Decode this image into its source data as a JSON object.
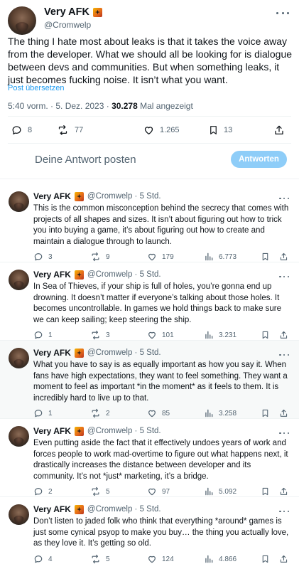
{
  "main_tweet": {
    "author_name": "Very AFK",
    "author_handle": "@Cromwelp",
    "text": "The thing I hate most about leaks is that it takes the voice away from the developer. What we should all be looking for is dialogue between devs and communities. But when something leaks, it just becomes fucking noise. It isn’t what you want.",
    "translate_link": "Post übersetzen",
    "timestamp": "5:40 vorm. · 5. Dez. 2023 · ",
    "views": "30.278",
    "views_label": " Mal angezeigt",
    "replies": "8",
    "reposts": "77",
    "likes": "1.265",
    "bookmarks": "13"
  },
  "composer": {
    "placeholder": "Deine Antwort posten",
    "button_label": "Antworten"
  },
  "replies": [
    {
      "author_name": "Very AFK",
      "author_handle": "@Cromwelp · 5 Std.",
      "text": "This is the common misconception behind the secrecy that comes with projects of all shapes and sizes. It isn’t about figuring out how to trick you into buying a game, it’s about figuring out how to create and maintain a dialogue through to launch.",
      "replies": "3",
      "reposts": "9",
      "likes": "179",
      "views": "6.773"
    },
    {
      "author_name": "Very AFK",
      "author_handle": "@Cromwelp · 5 Std.",
      "text": "In Sea of Thieves, if your ship is full of holes, you’re gonna end up drowning. It doesn’t matter if everyone’s talking about those holes. It becomes uncontrollable. In games we hold things back to make sure we can keep sailing; keep steering the ship.",
      "replies": "1",
      "reposts": "3",
      "likes": "101",
      "views": "3.231"
    },
    {
      "author_name": "Very AFK",
      "author_handle": "@Cromwelp · 5 Std.",
      "text": "What you have to say is as equally important as how you say it. When fans have high expectations, they want to feel something. They want a moment to feel as important *in the moment* as it feels to them. It is incredibly hard to live up to that.",
      "replies": "1",
      "reposts": "2",
      "likes": "85",
      "views": "3.258"
    },
    {
      "author_name": "Very AFK",
      "author_handle": "@Cromwelp · 5 Std.",
      "text": "Even putting aside the fact that it effectively undoes years of work and forces people to work mad-overtime to figure out what happens next, it drastically increases the distance between developer and its community. It’s not *just* marketing, it’s a bridge.",
      "replies": "2",
      "reposts": "5",
      "likes": "97",
      "views": "5.092"
    },
    {
      "author_name": "Very AFK",
      "author_handle": "@Cromwelp · 5 Std.",
      "text": "Don’t listen to jaded folk who think that everything *around* games is just some cynical psyop to make you buy… the thing you actually love, as they love it. It’s getting so old.",
      "replies": "4",
      "reposts": "5",
      "likes": "124",
      "views": "4.866"
    }
  ],
  "colors": {
    "accent": "#1d9bf0",
    "button_disabled": "#8ecdf8",
    "muted_text": "#536471",
    "divider": "#eff3f4"
  }
}
